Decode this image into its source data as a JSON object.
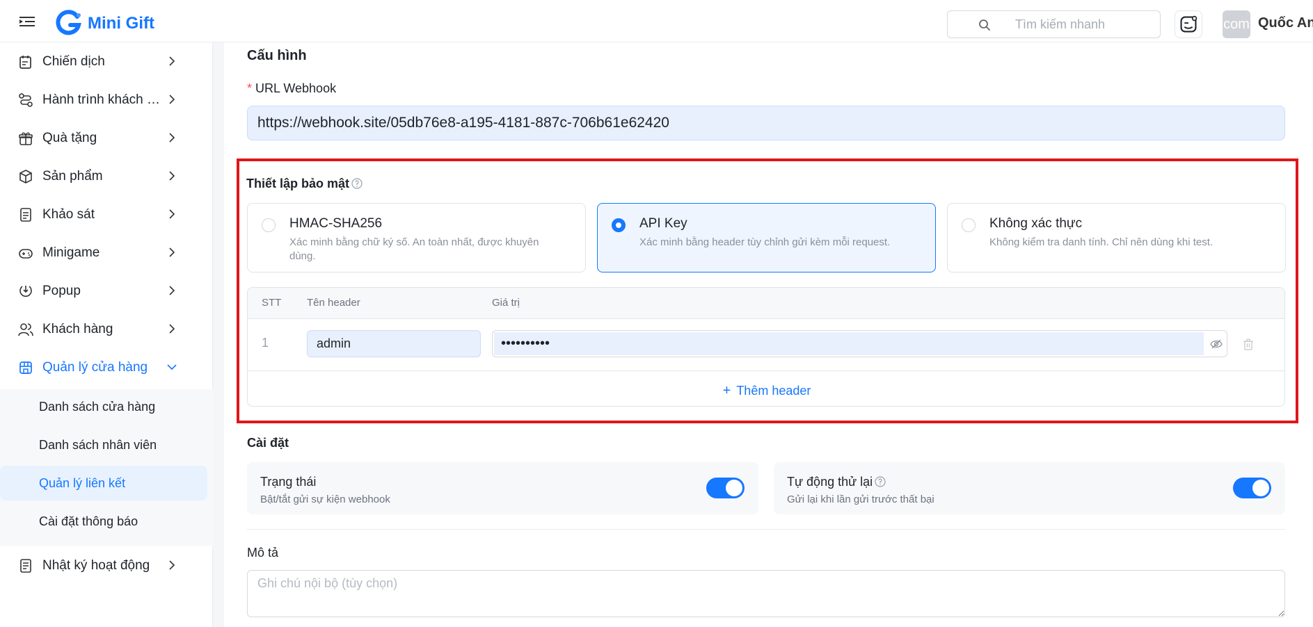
{
  "header": {
    "brand": "Mini Gift",
    "search_placeholder": "Tìm kiếm nhanh",
    "avatar_text": "com",
    "user_name": "Quốc An"
  },
  "sidebar": {
    "items": [
      {
        "label": "Chiến dịch",
        "icon": "calendar-note-icon"
      },
      {
        "label": "Hành trình khách hàng",
        "icon": "route-icon"
      },
      {
        "label": "Quà tặng",
        "icon": "gift-icon"
      },
      {
        "label": "Sản phẩm",
        "icon": "box-icon"
      },
      {
        "label": "Khảo sát",
        "icon": "survey-icon"
      },
      {
        "label": "Minigame",
        "icon": "gamepad-icon"
      },
      {
        "label": "Popup",
        "icon": "popup-icon"
      },
      {
        "label": "Khách hàng",
        "icon": "users-icon"
      },
      {
        "label": "Quản lý cửa hàng",
        "icon": "store-icon"
      },
      {
        "label": "Nhật ký hoạt động",
        "icon": "log-icon"
      }
    ],
    "submenu": [
      {
        "label": "Danh sách cửa hàng"
      },
      {
        "label": "Danh sách nhân viên"
      },
      {
        "label": "Quản lý liên kết"
      },
      {
        "label": "Cài đặt thông báo"
      }
    ]
  },
  "config": {
    "title": "Cấu hình",
    "url_label": "URL Webhook",
    "url_value": "https://webhook.site/05db76e8-a195-4181-887c-706b61e62420"
  },
  "security": {
    "title": "Thiết lập bảo mật",
    "options": [
      {
        "title": "HMAC-SHA256",
        "desc": "Xác minh bằng chữ ký số. An toàn nhất, được khuyên dùng.",
        "selected": false
      },
      {
        "title": "API Key",
        "desc": "Xác minh bằng header tùy chỉnh gửi kèm mỗi request.",
        "selected": true
      },
      {
        "title": "Không xác thực",
        "desc": "Không kiểm tra danh tính. Chỉ nên dùng khi test.",
        "selected": false
      }
    ],
    "table": {
      "col_index": "STT",
      "col_name": "Tên header",
      "col_value": "Giá trị",
      "rows": [
        {
          "index": "1",
          "name": "admin",
          "value": "••••••••••"
        }
      ],
      "add_label": "Thêm header"
    }
  },
  "settings": {
    "title": "Cài đặt",
    "status": {
      "title": "Trạng thái",
      "desc": "Bật/tắt gửi sự kiện webhook",
      "enabled": true
    },
    "retry": {
      "title": "Tự động thử lại",
      "desc": "Gửi lại khi lần gửi trước thất bại",
      "enabled": true
    }
  },
  "description": {
    "label": "Mô tả",
    "placeholder": "Ghi chú nội bộ (tùy chọn)"
  },
  "colors": {
    "accent": "#1677ff",
    "highlight": "#e0161a"
  }
}
